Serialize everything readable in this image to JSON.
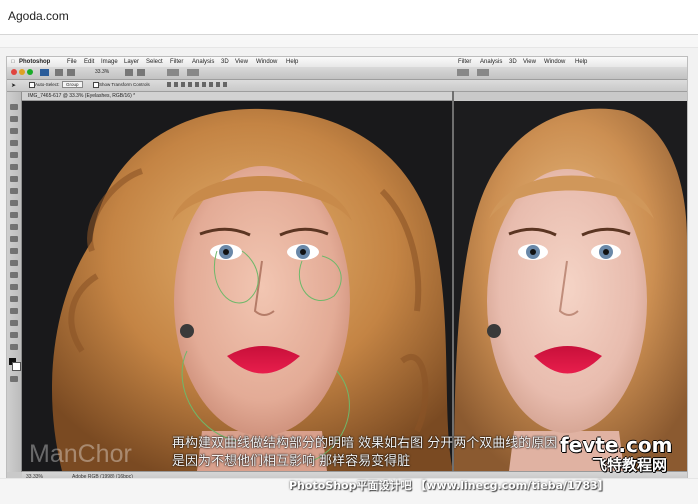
{
  "browser": {
    "title": "Agoda.com"
  },
  "photoshop": {
    "menu_left": [
      "Photoshop",
      "File",
      "Edit",
      "Image",
      "Layer",
      "Select",
      "Filter",
      "Analysis",
      "3D",
      "View",
      "Window",
      "Help"
    ],
    "menu_right": [
      "Filter",
      "Analysis",
      "3D",
      "View",
      "Window",
      "Help"
    ],
    "zoom": "33.3%",
    "options": {
      "auto_select": "Auto-Select:",
      "group": "Group",
      "transform": "Show Transform Controls"
    },
    "doc_tab": "IMG_7465-617 @ 33.3% (Eyelashes, RGB/16) *",
    "status_zoom": "33.33%",
    "status_profile": "Adobe RGB (1998) (16bpc)"
  },
  "caption": {
    "line1": "再构建双曲线做结构部分的明暗 效果如右图 分开两个双曲线的原因",
    "line2": "是因为不想他们相互影响 那样容易变得脏"
  },
  "watermarks": {
    "author": "ManChor",
    "site_logo": "fevte.com",
    "site_name": "飞特教程网",
    "footer": "PhotoShop平面设计吧 【www.linecg.com/tieba/1783】"
  },
  "colors": {
    "lips": "#d8143f",
    "skin": "#e9b9a6",
    "hair": "#c9884a",
    "background": "#1b1b1d"
  }
}
